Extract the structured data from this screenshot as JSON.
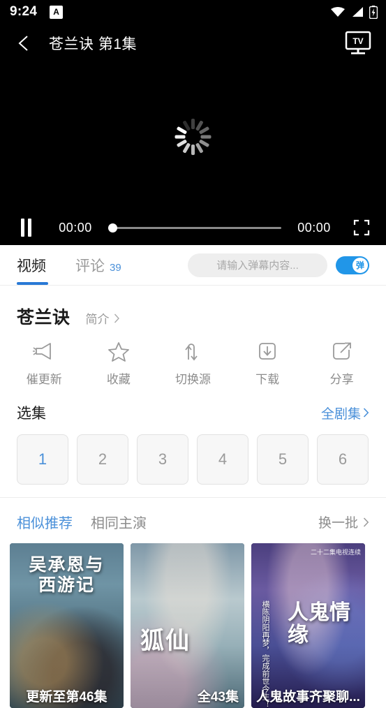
{
  "status_bar": {
    "time": "9:24",
    "app_badge": "A",
    "icons": [
      "wifi-icon",
      "signal-icon",
      "battery-charging-icon"
    ]
  },
  "title_bar": {
    "back_icon": "back-chevron-icon",
    "title": "苍兰诀 第1集",
    "cast_icon": "tv-cast-icon",
    "cast_label": "TV"
  },
  "player": {
    "state": "loading",
    "loading_icon": "loading-spinner-icon",
    "pause_icon": "pause-icon",
    "current_time": "00:00",
    "total_time": "00:00",
    "progress_percent": 0,
    "fullscreen_icon": "fullscreen-icon"
  },
  "tabs": {
    "items": [
      {
        "label": "视频",
        "count": "",
        "active": true
      },
      {
        "label": "评论",
        "count": "39",
        "active": false
      }
    ],
    "danmaku_placeholder": "请输入弹幕内容...",
    "danmaku_toggle_label": "弹",
    "danmaku_toggle_on": true,
    "accent_color": "#2979d6"
  },
  "show": {
    "title": "苍兰诀",
    "brief_label": "简介",
    "brief_icon": "chevron-right-icon"
  },
  "actions": [
    {
      "label": "催更新",
      "icon": "megaphone-icon"
    },
    {
      "label": "收藏",
      "icon": "star-icon"
    },
    {
      "label": "切换源",
      "icon": "swap-arrows-icon"
    },
    {
      "label": "下载",
      "icon": "download-icon"
    },
    {
      "label": "分享",
      "icon": "share-icon"
    }
  ],
  "episodes": {
    "section_title": "选集",
    "all_link": "全剧集",
    "all_link_icon": "chevron-right-icon",
    "items": [
      {
        "number": "1",
        "selected": true
      },
      {
        "number": "2",
        "selected": false
      },
      {
        "number": "3",
        "selected": false
      },
      {
        "number": "4",
        "selected": false
      },
      {
        "number": "5",
        "selected": false
      },
      {
        "number": "6",
        "selected": false
      }
    ]
  },
  "recommend": {
    "tabs": [
      {
        "label": "相似推荐",
        "active": true
      },
      {
        "label": "相同主演",
        "active": false
      }
    ],
    "refresh_label": "换一批",
    "refresh_icon": "chevron-right-icon",
    "cards": [
      {
        "art_title": "吴承恩与\n西游记",
        "caption": "更新至第46集"
      },
      {
        "art_title": "狐仙",
        "caption": "全43集"
      },
      {
        "art_title": "人鬼情缘",
        "caption": "人鬼故事齐聚聊...",
        "side_text": "横陈阴阳再梦，完成前世今生！",
        "top_text": "二十二集电视连续"
      }
    ]
  },
  "colors": {
    "accent_blue": "#4a90d9",
    "tab_indicator": "#2979d6",
    "toggle_on": "#2196e8",
    "text_primary": "#1a1a1a",
    "text_muted": "#8c8c8c"
  }
}
